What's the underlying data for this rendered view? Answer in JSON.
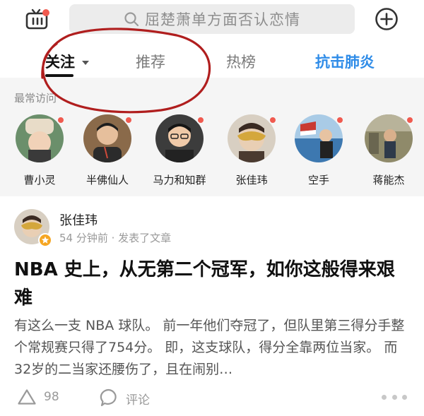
{
  "top_bar": {
    "search_placeholder": "屈楚萧单方面否认恋情"
  },
  "tabs": [
    {
      "label": "关注",
      "active": true
    },
    {
      "label": "推荐",
      "active": false
    },
    {
      "label": "热榜",
      "active": false
    },
    {
      "label": "抗击肺炎",
      "active": false,
      "highlight_color": "#2f8ce8"
    }
  ],
  "recent": {
    "title": "最常访问",
    "users": [
      {
        "name": "曹小灵"
      },
      {
        "name": "半佛仙人"
      },
      {
        "name": "马力和知群"
      },
      {
        "name": "张佳玮"
      },
      {
        "name": "空手"
      },
      {
        "name": "蒋能杰"
      }
    ]
  },
  "article": {
    "author": "张佳玮",
    "meta": "54 分钟前 · 发表了文章",
    "headline": "NBA 史上，从无第二个冠军，如你这般得来艰难",
    "excerpt": "有这么一支 NBA 球队。 前一年他们夺冠了，但队里第三得分手整个常规赛只得了754分。 即，这支球队，得分全靠两位当家。 而32岁的二当家还腰伤了，且在闹别…",
    "upvotes": "98",
    "comment_label": "评论"
  },
  "colors": {
    "accent_blue": "#2f8ce8",
    "notification_red": "#f05a4f",
    "annotation_red": "#b01e1e"
  }
}
